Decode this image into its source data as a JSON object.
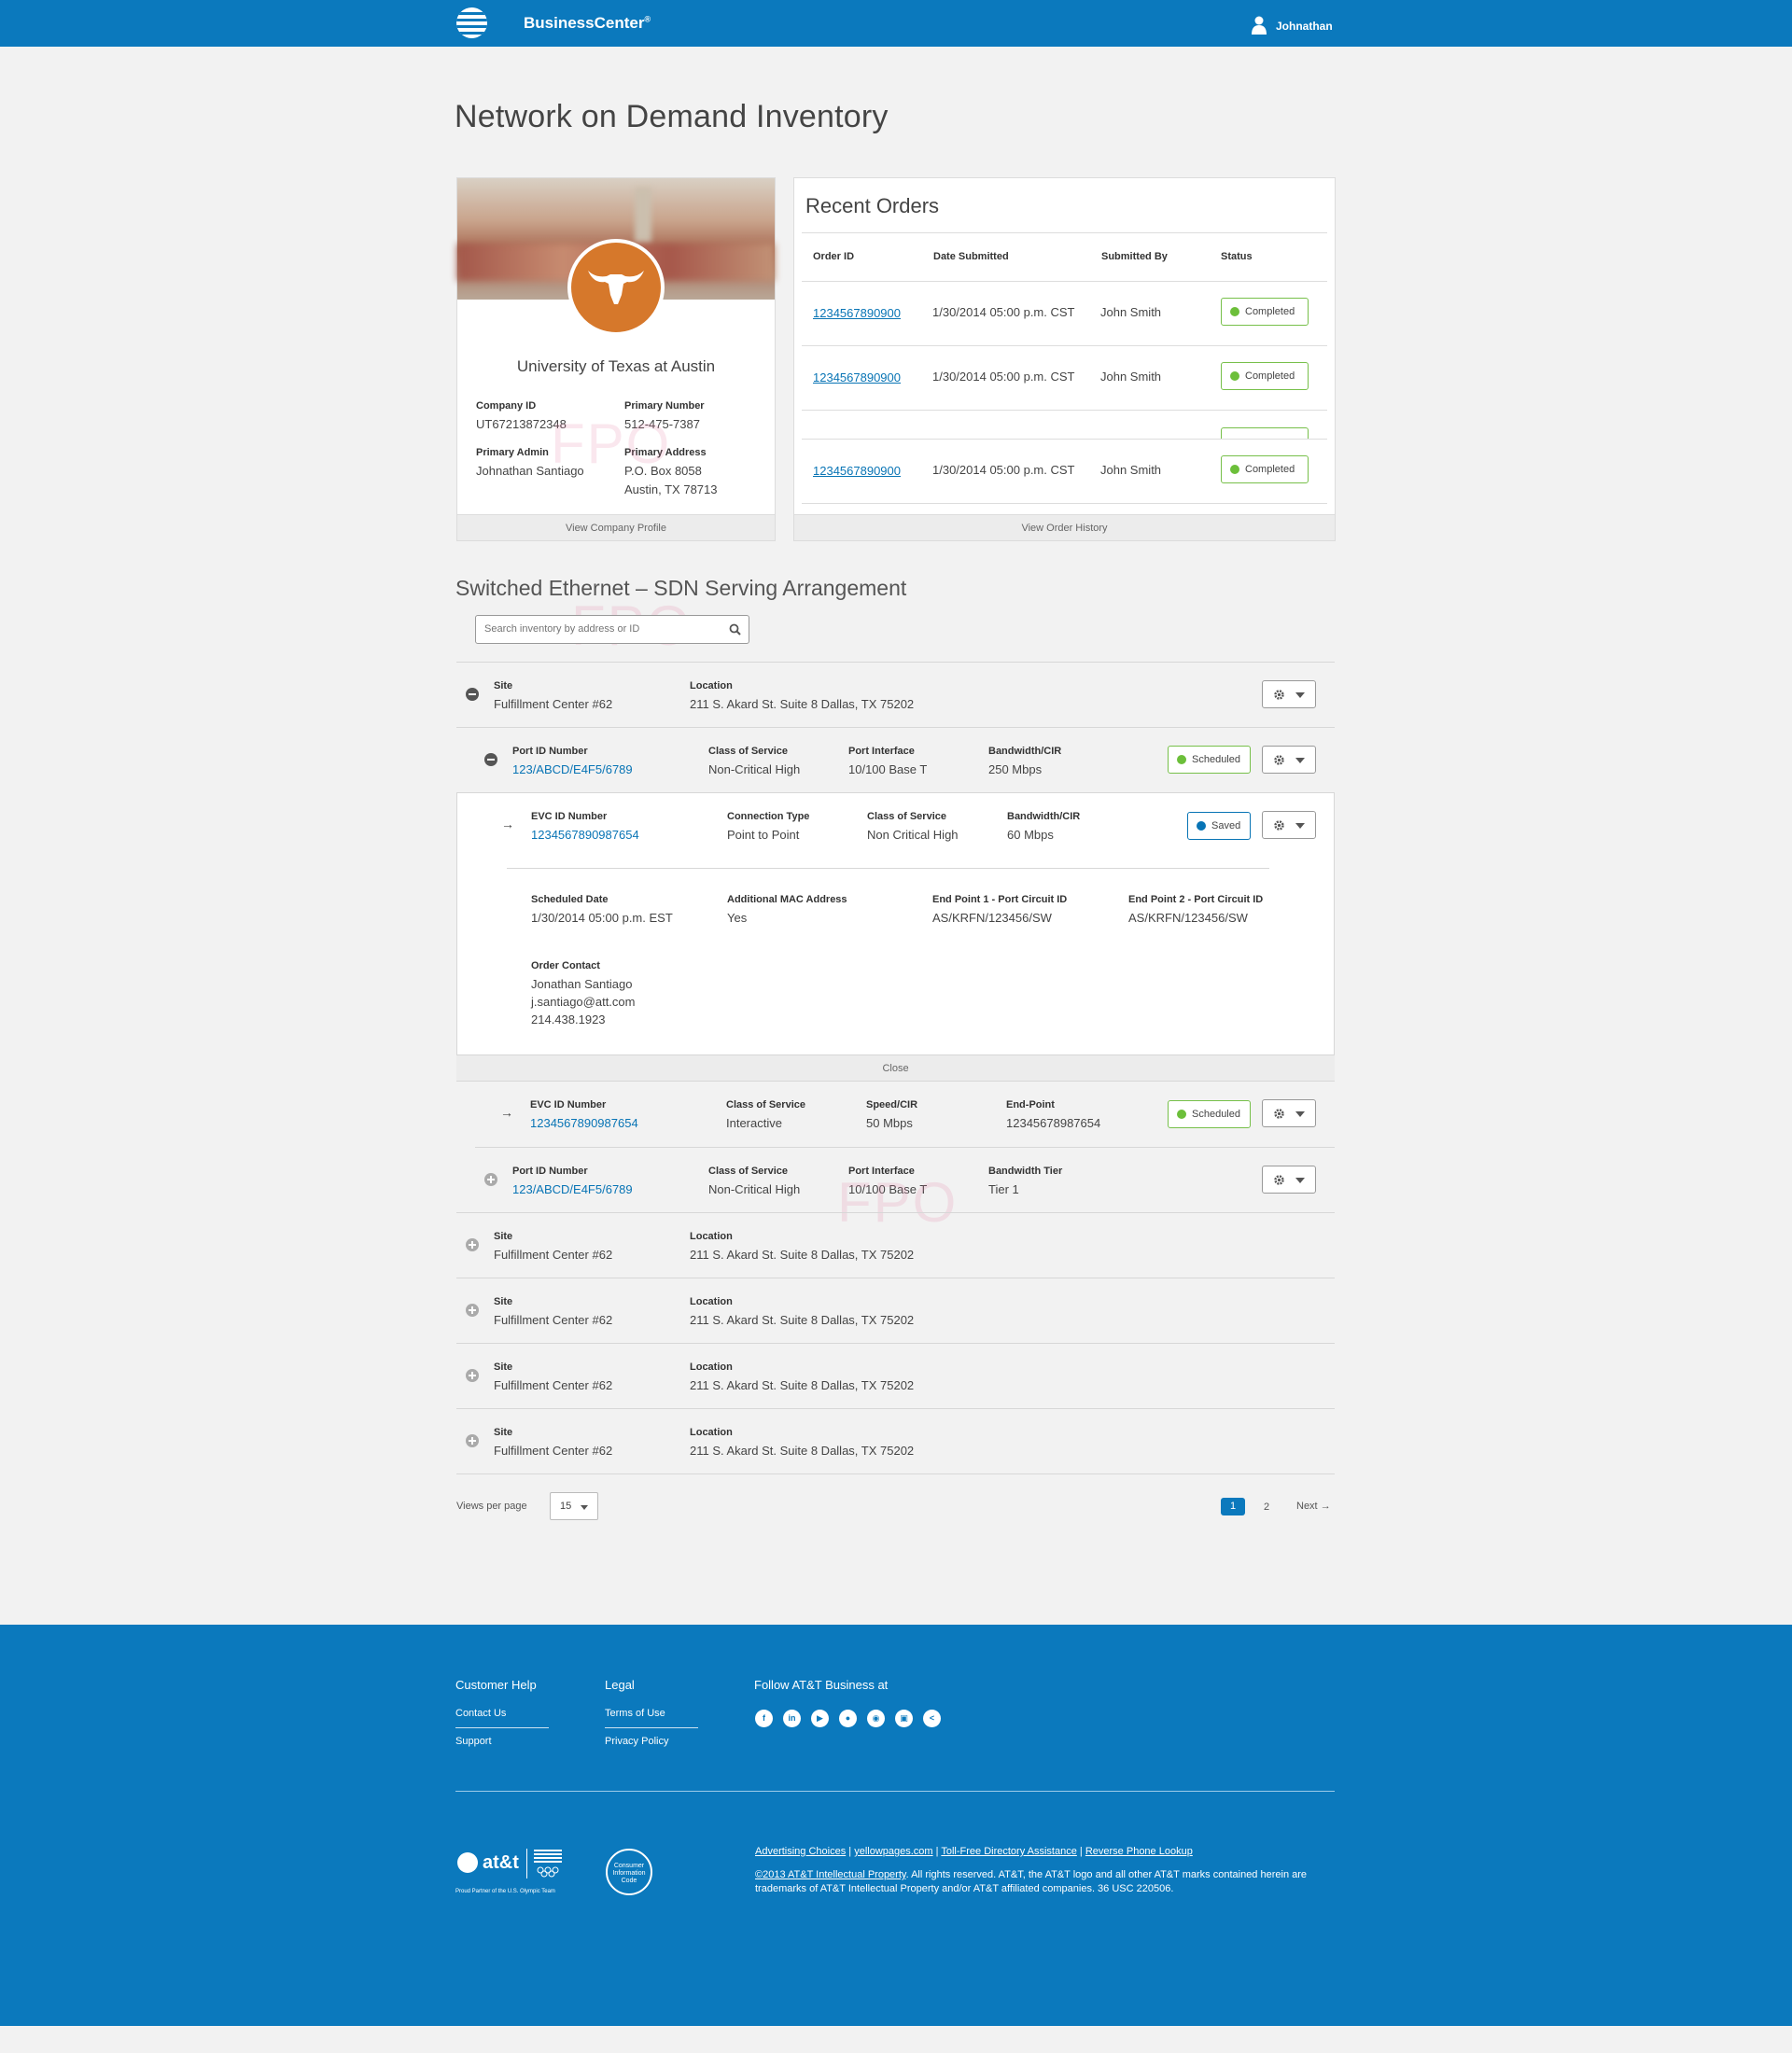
{
  "header": {
    "brand": "BusinessCenter",
    "brand_mark": "®",
    "user": "Johnathan"
  },
  "page_title": "Network on Demand Inventory",
  "company": {
    "name": "University of Texas at Austin",
    "company_id_label": "Company ID",
    "company_id": "UT67213872348",
    "primary_number_label": "Primary Number",
    "primary_number": "512-475-7387",
    "primary_admin_label": "Primary Admin",
    "primary_admin": "Johnathan Santiago",
    "primary_address_label": "Primary Address",
    "address_line1": "P.O. Box 8058",
    "address_line2": "Austin, TX 78713",
    "fpo": "FPO",
    "footer_link": "View Company Profile"
  },
  "orders": {
    "title": "Recent Orders",
    "headers": [
      "Order ID",
      "Date Submitted",
      "Submitted By",
      "Status"
    ],
    "rows": [
      {
        "id": "1234567890900",
        "date": "1/30/2014 05:00 p.m. CST",
        "by": "John Smith",
        "status": "Completed"
      },
      {
        "id": "1234567890900",
        "date": "1/30/2014 05:00 p.m. CST",
        "by": "John Smith",
        "status": "Completed"
      },
      {
        "id": "1234567890900",
        "date": "1/30/2014 05:00 p.m. CST",
        "by": "John Smith",
        "status": "Completed"
      }
    ],
    "footer_link": "View Order History"
  },
  "section_title": "Switched Ethernet – SDN Serving Arrangement",
  "search": {
    "placeholder": "Search inventory by address or ID"
  },
  "site1": {
    "site_label": "Site",
    "site": "Fulfillment Center #62",
    "location_label": "Location",
    "location": "211 S. Akard St. Suite 8 Dallas, TX 75202"
  },
  "port1": {
    "port_label": "Port ID Number",
    "port": "123/ABCD/E4F5/6789",
    "cos_label": "Class of Service",
    "cos": "Non-Critical High",
    "iface_label": "Port Interface",
    "iface": "10/100 Base T",
    "bw_label": "Bandwidth/CIR",
    "bw": "250 Mbps",
    "status": "Scheduled"
  },
  "evc1": {
    "evc_label": "EVC ID Number",
    "evc": "1234567890987654",
    "conn_label": "Connection Type",
    "conn": "Point to Point",
    "cos_label": "Class of Service",
    "cos": "Non Critical High",
    "bw_label": "Bandwidth/CIR",
    "bw": "60 Mbps",
    "status": "Saved",
    "sched_label": "Scheduled Date",
    "sched": "1/30/2014 05:00 p.m. EST",
    "mac_label": "Additional MAC Address",
    "mac": "Yes",
    "ep1_label": "End Point 1 - Port Circuit ID",
    "ep1": "AS/KRFN/123456/SW",
    "ep2_label": "End Point 2 - Port Circuit ID",
    "ep2": "AS/KRFN/123456/SW",
    "contact_label": "Order Contact",
    "contact_name": "Jonathan Santiago",
    "contact_email": "j.santiago@att.com",
    "contact_phone": "214.438.1923",
    "close": "Close"
  },
  "evc2": {
    "evc_label": "EVC ID Number",
    "evc": "1234567890987654",
    "cos_label": "Class of Service",
    "cos": "Interactive",
    "speed_label": "Speed/CIR",
    "speed": "50 Mbps",
    "end_label": "End-Point",
    "end": "12345678987654",
    "status": "Scheduled"
  },
  "port2": {
    "port_label": "Port ID Number",
    "port": "123/ABCD/E4F5/6789",
    "cos_label": "Class of Service",
    "cos": "Non-Critical High",
    "iface_label": "Port Interface",
    "iface": "10/100 Base T",
    "tier_label": "Bandwidth Tier",
    "tier": "Tier 1",
    "fpo": "FPO"
  },
  "sites": [
    {
      "site_label": "Site",
      "site": "Fulfillment Center #62",
      "location_label": "Location",
      "location": "211 S. Akard St. Suite 8 Dallas, TX 75202"
    },
    {
      "site_label": "Site",
      "site": "Fulfillment Center #62",
      "location_label": "Location",
      "location": "211 S. Akard St. Suite 8 Dallas, TX 75202"
    },
    {
      "site_label": "Site",
      "site": "Fulfillment Center #62",
      "location_label": "Location",
      "location": "211 S. Akard St. Suite 8 Dallas, TX 75202"
    },
    {
      "site_label": "Site",
      "site": "Fulfillment Center #62",
      "location_label": "Location",
      "location": "211 S. Akard St. Suite 8 Dallas, TX 75202"
    }
  ],
  "pagination": {
    "views_label": "Views per page",
    "views_value": "15",
    "page1": "1",
    "page2": "2",
    "next": "Next"
  },
  "footer": {
    "help_title": "Customer Help",
    "contact": "Contact Us",
    "support": "Support",
    "legal_title": "Legal",
    "terms": "Terms of Use",
    "privacy": "Privacy Policy",
    "follow_title": "Follow AT&T Business at",
    "att_logo_text": "at&t",
    "att_tagline": "Proud Partner of the U.S. Olympic Team",
    "cic_badge": "Consumer Information Code",
    "links": [
      "Advertising Choices",
      "yellowpages.com",
      "Toll-Free Directory Assistance",
      "Reverse Phone Lookup"
    ],
    "copyright_link": "©2013 AT&T Intellectual Property",
    "copyright_text": ". All rights reserved. AT&T, the AT&T logo and all other AT&T marks contained herein are trademarks of AT&T Intellectual Property and/or AT&T affiliated companies. 36 USC 220506."
  },
  "colors": {
    "brand_blue": "#0b79bd",
    "link_blue": "#0874b5",
    "status_green": "#6cbf3a",
    "longhorn_orange": "#d6782b"
  }
}
